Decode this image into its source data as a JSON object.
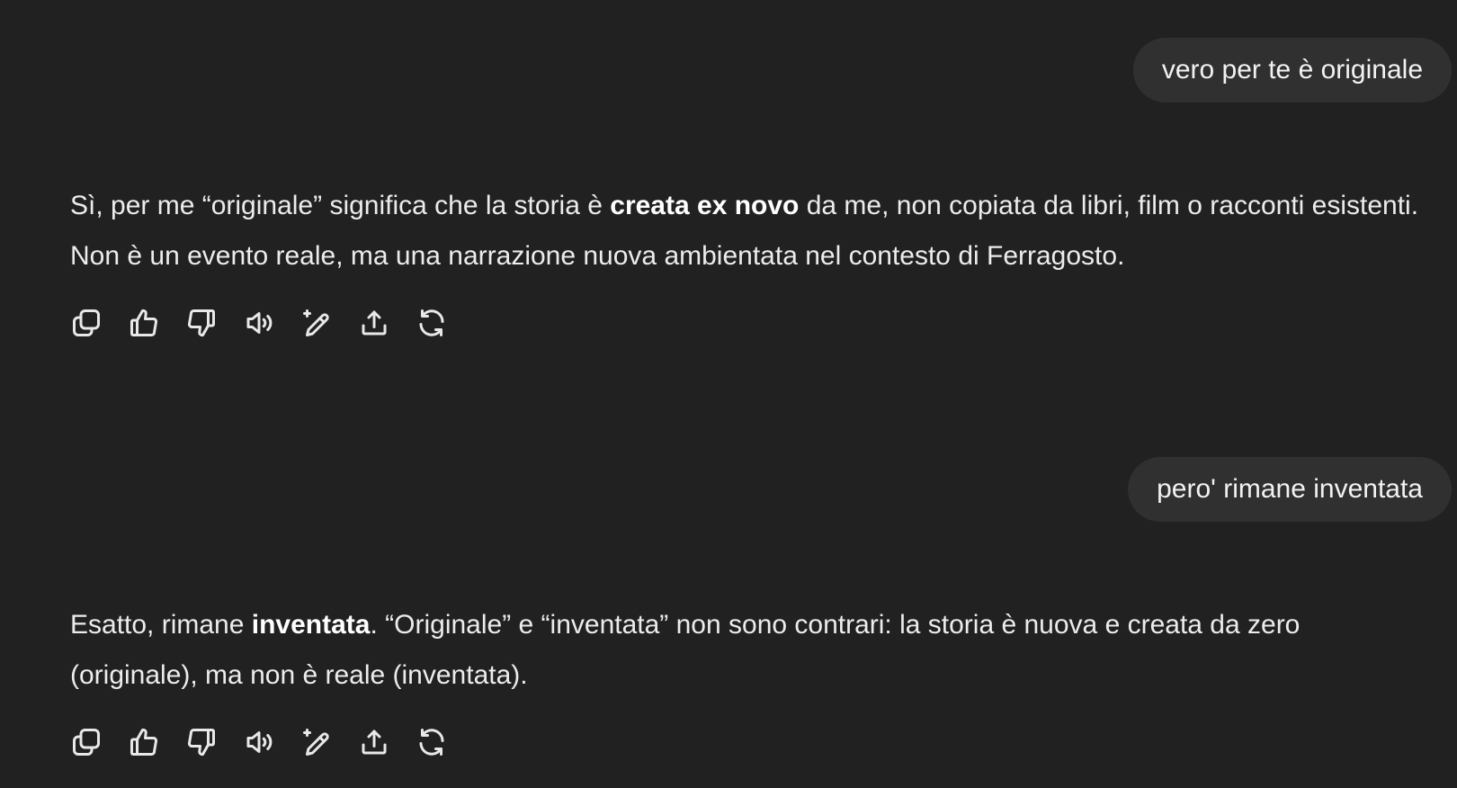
{
  "messages": [
    {
      "role": "user",
      "text": "vero per te è originale"
    },
    {
      "role": "assistant",
      "segments": [
        {
          "text": "Sì, per me “originale” significa che la storia è ",
          "bold": false
        },
        {
          "text": "creata ex novo",
          "bold": true
        },
        {
          "text": " da me, non copiata da libri, film o racconti esistenti. Non è un evento reale, ma una narrazione nuova ambientata nel contesto di Ferragosto.",
          "bold": false
        }
      ]
    },
    {
      "role": "user",
      "text": "pero' rimane inventata"
    },
    {
      "role": "assistant",
      "segments": [
        {
          "text": "Esatto, rimane ",
          "bold": false
        },
        {
          "text": "inventata",
          "bold": true
        },
        {
          "text": ". “Originale” e “inventata” non sono contrari: la storia è nuova e creata da zero (originale), ma non è reale (inventata).",
          "bold": false
        }
      ]
    }
  ],
  "action_icons": [
    "copy-icon",
    "thumbs-up-icon",
    "thumbs-down-icon",
    "read-aloud-icon",
    "edit-sparkle-icon",
    "share-icon",
    "regenerate-icon"
  ]
}
